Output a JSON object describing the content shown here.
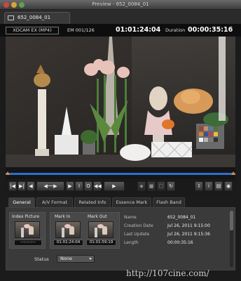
{
  "window": {
    "title": "Preview - 652_0084_01"
  },
  "clip_tab": {
    "label": "652_0084_01",
    "icon": "clip-icon"
  },
  "info": {
    "format": "XDCAM EX (MP4)",
    "em": "EM 001/126",
    "current_tc": "01:01:24:04",
    "duration_label": "Duration",
    "duration_tc": "00:00:35:16"
  },
  "controls": {
    "buttons": [
      "|◀",
      "▶|",
      "◀|",
      "◀▶",
      "◀▶",
      "▶|",
      "◀◀",
      "▶▶",
      "▶",
      "▣",
      "▣",
      "▣",
      "▣",
      "▣",
      "▣",
      "▣"
    ]
  },
  "tabs": [
    "General",
    "A/V Format",
    "Related Info",
    "Essence Mark",
    "Flash Band"
  ],
  "groups": {
    "index_picture": {
      "label": "Index Picture",
      "tc": "--:--:--:--"
    },
    "mark_in": {
      "label": "Mark In",
      "tc": "01:01:24:04"
    },
    "mark_out": {
      "label": "Mark Out",
      "tc": "01:01:59:19"
    }
  },
  "properties": [
    {
      "label": "Name",
      "value": "652_0084_01"
    },
    {
      "label": "Creation Date",
      "value": "Jul 26, 2011 9:15:00"
    },
    {
      "label": "Last Update",
      "value": "Jul 26, 2011 9:15:36"
    },
    {
      "label": "Length",
      "value": "00:00:35:16"
    }
  ],
  "status": {
    "label": "Status",
    "value": "None"
  },
  "watermark": "http://107cine.com/"
}
